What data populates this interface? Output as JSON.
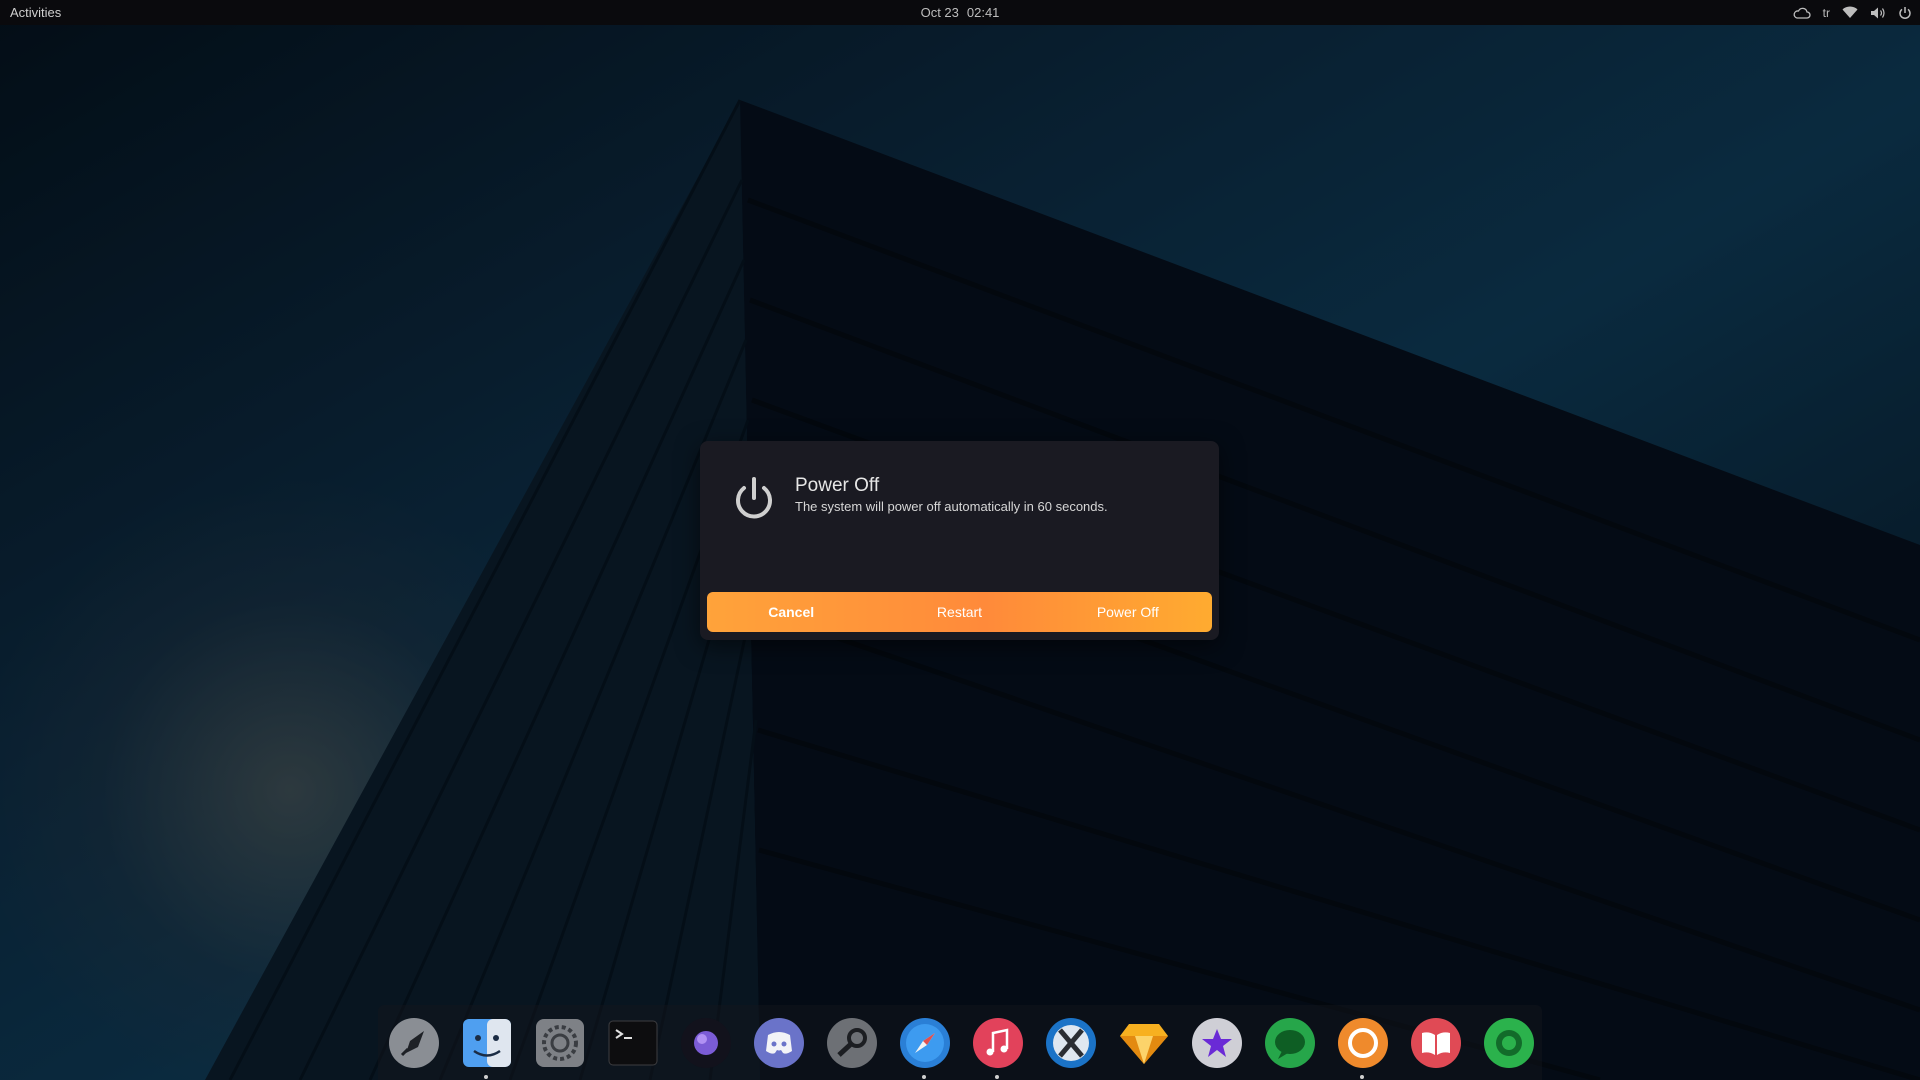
{
  "topbar": {
    "activities_label": "Activities",
    "date": "Oct 23",
    "time": "02:41",
    "keyboard_layout": "tr",
    "tray_icons": [
      "cloud-icon",
      "wifi-icon",
      "volume-icon",
      "power-icon"
    ]
  },
  "dialog": {
    "icon": "power-icon",
    "title": "Power Off",
    "description": "The system will power off automatically in 60 seconds.",
    "buttons": {
      "cancel": "Cancel",
      "restart": "Restart",
      "power_off": "Power Off"
    },
    "accent_color": "#ff9a3a"
  },
  "dock": {
    "items": [
      {
        "icon": "launchpad-rocket-icon",
        "running": false
      },
      {
        "icon": "finder-icon",
        "running": true
      },
      {
        "icon": "system-settings-icon",
        "running": false
      },
      {
        "icon": "terminal-icon",
        "running": false
      },
      {
        "icon": "browser-orb-icon",
        "running": false
      },
      {
        "icon": "discord-icon",
        "running": false
      },
      {
        "icon": "steam-icon",
        "running": false
      },
      {
        "icon": "safari-compass-icon",
        "running": true
      },
      {
        "icon": "music-icon",
        "running": true
      },
      {
        "icon": "xcode-icon",
        "running": false
      },
      {
        "icon": "sketch-gem-icon",
        "running": false
      },
      {
        "icon": "star-app-icon",
        "running": false
      },
      {
        "icon": "messages-icon",
        "running": false
      },
      {
        "icon": "ubuntu-software-icon",
        "running": true
      },
      {
        "icon": "books-icon",
        "running": false
      },
      {
        "icon": "spotify-icon",
        "running": false
      }
    ]
  }
}
